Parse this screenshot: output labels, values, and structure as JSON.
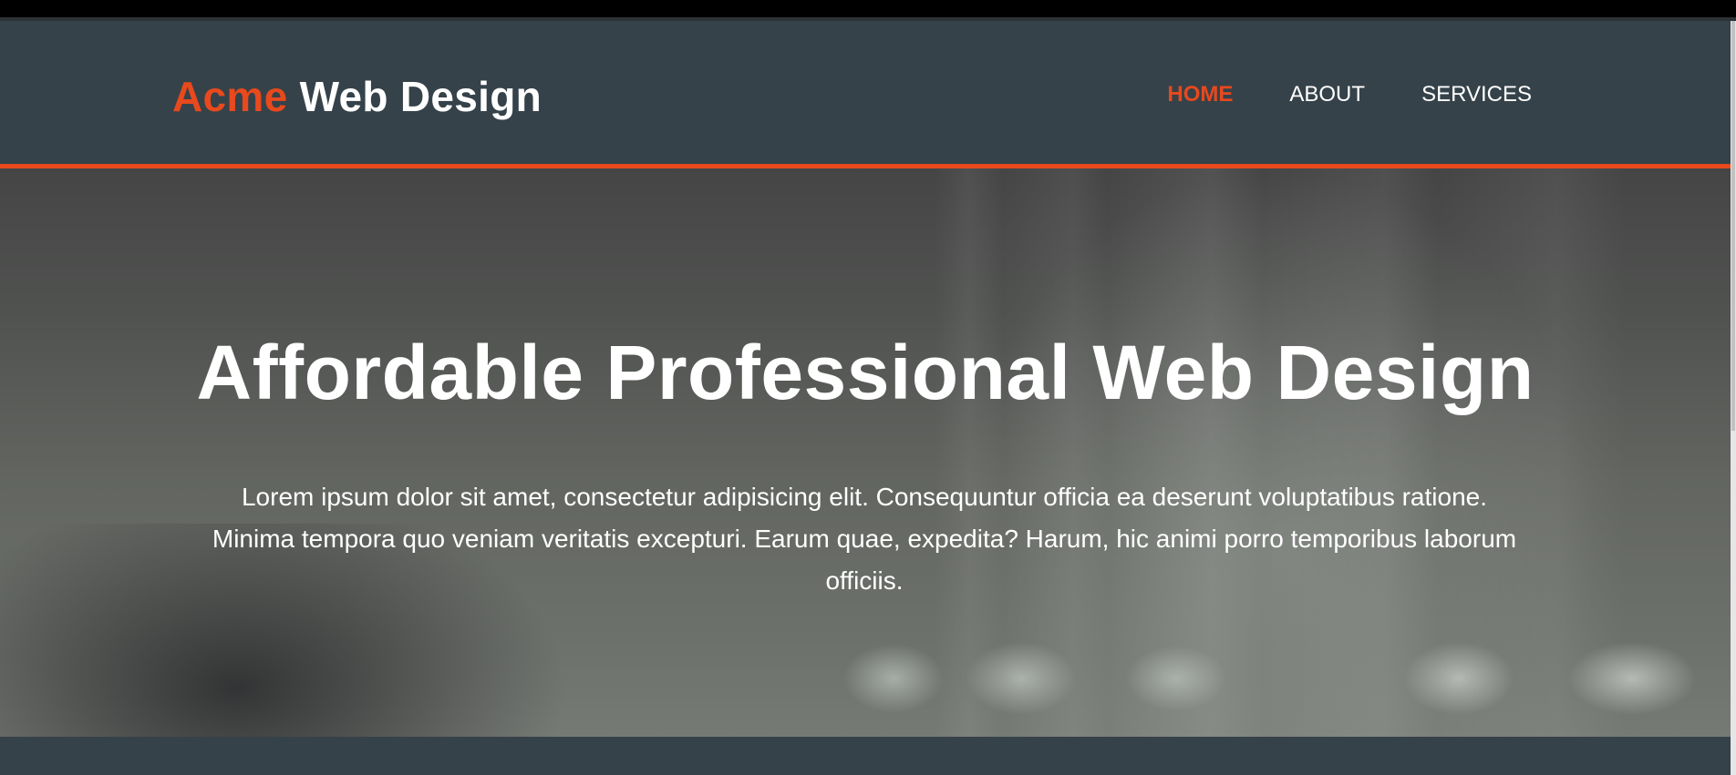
{
  "header": {
    "brand_highlight": "Acme",
    "brand_rest": "Web Design"
  },
  "nav": {
    "items": [
      {
        "label": "Home",
        "current": true
      },
      {
        "label": "About",
        "current": false
      },
      {
        "label": "Services",
        "current": false
      }
    ]
  },
  "showcase": {
    "title": "Affordable Professional Web Design",
    "text": "Lorem ipsum dolor sit amet, consectetur adipisicing elit. Consequuntur officia ea deserunt voluptatibus ratione. Minima tempora quo veniam veritatis excepturi. Earum quae, expedita? Harum, hic animi porro temporibus laborum officiis."
  },
  "colors": {
    "accent": "#e8491d",
    "header_bg": "#35424a",
    "text": "#ffffff"
  }
}
